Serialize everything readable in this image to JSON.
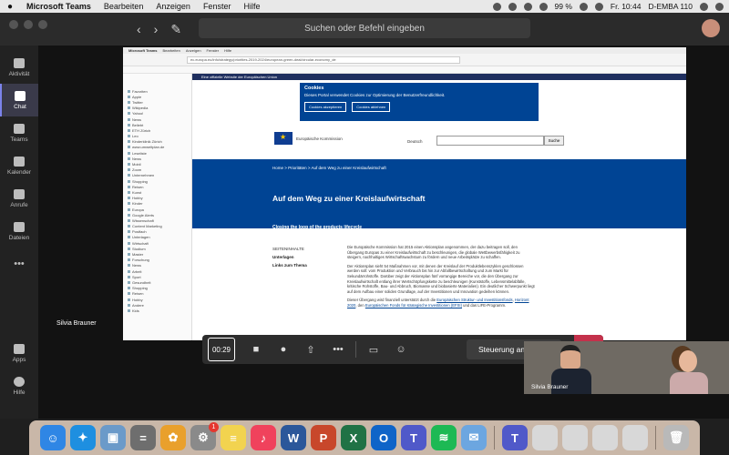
{
  "menubar": {
    "app_name": "Microsoft Teams",
    "items": [
      "Bearbeiten",
      "Anzeigen",
      "Fenster",
      "Hilfe"
    ],
    "battery": "99 %",
    "clock": "Fr. 10:44",
    "user": "D-EMBA 110"
  },
  "titlebar": {
    "search_placeholder": "Suchen oder Befehl eingeben"
  },
  "rail": {
    "items": [
      {
        "label": "Aktivität",
        "icon": "bell-icon"
      },
      {
        "label": "Chat",
        "icon": "chat-icon"
      },
      {
        "label": "Teams",
        "icon": "teams-icon"
      },
      {
        "label": "Kalender",
        "icon": "calendar-icon"
      },
      {
        "label": "Anrufe",
        "icon": "phone-icon"
      },
      {
        "label": "Dateien",
        "icon": "file-icon"
      },
      {
        "label": "•••",
        "icon": "more-icon"
      }
    ],
    "bottom": [
      {
        "label": "Apps",
        "icon": "apps-icon"
      },
      {
        "label": "Hilfe",
        "icon": "help-icon"
      }
    ]
  },
  "shared": {
    "ie_menu": [
      "Microsoft Teams",
      "Bearbeiten",
      "Anzeigen",
      "Fenster",
      "Hilfe"
    ],
    "url": "ec.europa.eu/info/strategy/priorities-2019-2024/european-green-deal/circular-economy_de",
    "sidebar_rows": [
      "Favoriten",
      "Apple",
      "Twitter",
      "Wikipedia",
      "Yahoo!",
      "News",
      "Beliebt",
      "ETH Zürich",
      "Leo",
      "Kinderklinik Zürich",
      "www.umweltplan.de",
      "Leseliste",
      "News",
      "Mobil",
      "Zoom",
      "Unternehmen",
      "Shopping",
      "Reisen",
      "Kunst",
      "Hobby",
      "Kinder",
      "Europa",
      "Google Alerts",
      "Wissenschaft",
      "Content Marketing",
      "Postfach",
      "Unterlagen",
      "Wirtschaft",
      "Studium",
      "Master",
      "Forschung",
      "News",
      "Arbeit",
      "Sport",
      "Gesundheit",
      "Shopping",
      "Reisen",
      "Hobby",
      "Andere",
      "Kids"
    ],
    "eu_banner": "Eine offizielle Website der Europäischen Union",
    "cookie": {
      "title": "Cookies",
      "text": "Dieses Portal verwendet Cookies zur Optimierung der Benutzerfreundlichkeit.",
      "accept": "Cookies akzeptieren",
      "decline": "Cookies ablehnen"
    },
    "eu_name": "Europäische Kommission",
    "lang": "Deutsch",
    "search_btn": "Suche",
    "crumbs": "Home  >  Prioritäten  >  Auf dem Weg zu einer Kreislaufwirtschaft",
    "title": "Auf dem Weg zu einer Kreislaufwirtschaft",
    "subtitle": "Closing the loop of the products lifecycle",
    "side_label": "SEITENINHALTE",
    "side_links": [
      "Unterlagen",
      "Links zum Thema"
    ],
    "para1": "Die Europäische Kommission hat 2015 einen Aktionsplan angenommen, der dazu beitragen soll, den Übergang Europas zu einer Kreislaufwirtschaft zu beschleunigen, die globale Wettbewerbsfähigkeit zu steigern, nachhaltiges Wirtschaftswachstum zu fördern und neue Arbeitsplätze zu schaffen.",
    "para2": "Der Aktionsplan sieht 54 Maßnahmen vor, mit denen der Kreislauf der Produktlebenszyklen geschlossen werden soll: vom Produktion und Verbrauch bis hin zur Abfallbewirtschaftung und zum Markt für Sekundärrohstoffe. Darüber zeigt der Aktionsplan fünf vorrangige Bereiche vor, die den Übergang zur Kreislaufwirtschaft entlang ihrer Wertschöpfungskette zu beschleunigen (Kunststoffe, Lebensmittelabfälle, kritische Rohstoffe, Bau- und Abbruch, Biomasse und biobasierte Materialien). Ein deutlicher Schwerpunkt liegt auf dem Aufbau einer soliden Grundlage, auf der Investitionen und Innovation gedeihen können.",
    "para3_pre": "Dieser Übergang wird finanziell unterstützt durch die",
    "para3_link1": "Europäischen Struktur- und Investitionsfonds",
    "para3_link2": "Horizont 2020",
    "para3_mid": ", den",
    "para3_link3": "Europäischen Fonds für strategische Investitionen (EFSI)",
    "para3_post": " und das LIFE-Programm."
  },
  "callbar": {
    "timer": "00:29",
    "control": "Steuerung anfordern"
  },
  "participants": {
    "left_name": "Silvia Brauner",
    "video_name": "Silvia Brauner"
  },
  "dock": {
    "badge_count": "1",
    "apps": [
      {
        "name": "finder-icon",
        "color": "#2f86e5",
        "glyph": "☺"
      },
      {
        "name": "safari-icon",
        "color": "#1e8fe0",
        "glyph": "✦"
      },
      {
        "name": "preview-icon",
        "color": "#6b9ac9",
        "glyph": "▣"
      },
      {
        "name": "calculator-icon",
        "color": "#6e6e6e",
        "glyph": "="
      },
      {
        "name": "photos-icon",
        "color": "#e9a02c",
        "glyph": "✿"
      },
      {
        "name": "system-prefs-icon",
        "color": "#8a8a8a",
        "glyph": "⚙"
      },
      {
        "name": "notes-icon",
        "color": "#f2d34f",
        "glyph": "≡"
      },
      {
        "name": "music-icon",
        "color": "#f0425c",
        "glyph": "♪"
      },
      {
        "name": "word-icon",
        "color": "#2b579a",
        "glyph": "W"
      },
      {
        "name": "powerpoint-icon",
        "color": "#c8472b",
        "glyph": "P"
      },
      {
        "name": "excel-icon",
        "color": "#207245",
        "glyph": "X"
      },
      {
        "name": "outlook-icon",
        "color": "#0f64c8",
        "glyph": "O"
      },
      {
        "name": "teams-icon",
        "color": "#5059c9",
        "glyph": "T"
      },
      {
        "name": "spotify-icon",
        "color": "#1db954",
        "glyph": "≋"
      },
      {
        "name": "mail-icon",
        "color": "#6ca6e0",
        "glyph": "✉"
      },
      {
        "name": "teams2-icon",
        "color": "#5059c9",
        "glyph": "T"
      },
      {
        "name": "window1-icon",
        "color": "#d8d8d8",
        "glyph": ""
      },
      {
        "name": "window2-icon",
        "color": "#d8d8d8",
        "glyph": ""
      },
      {
        "name": "window3-icon",
        "color": "#d8d8d8",
        "glyph": ""
      },
      {
        "name": "window4-icon",
        "color": "#d8d8d8",
        "glyph": ""
      },
      {
        "name": "trash-icon",
        "color": "#b9b9b9",
        "glyph": "🗑"
      }
    ]
  }
}
